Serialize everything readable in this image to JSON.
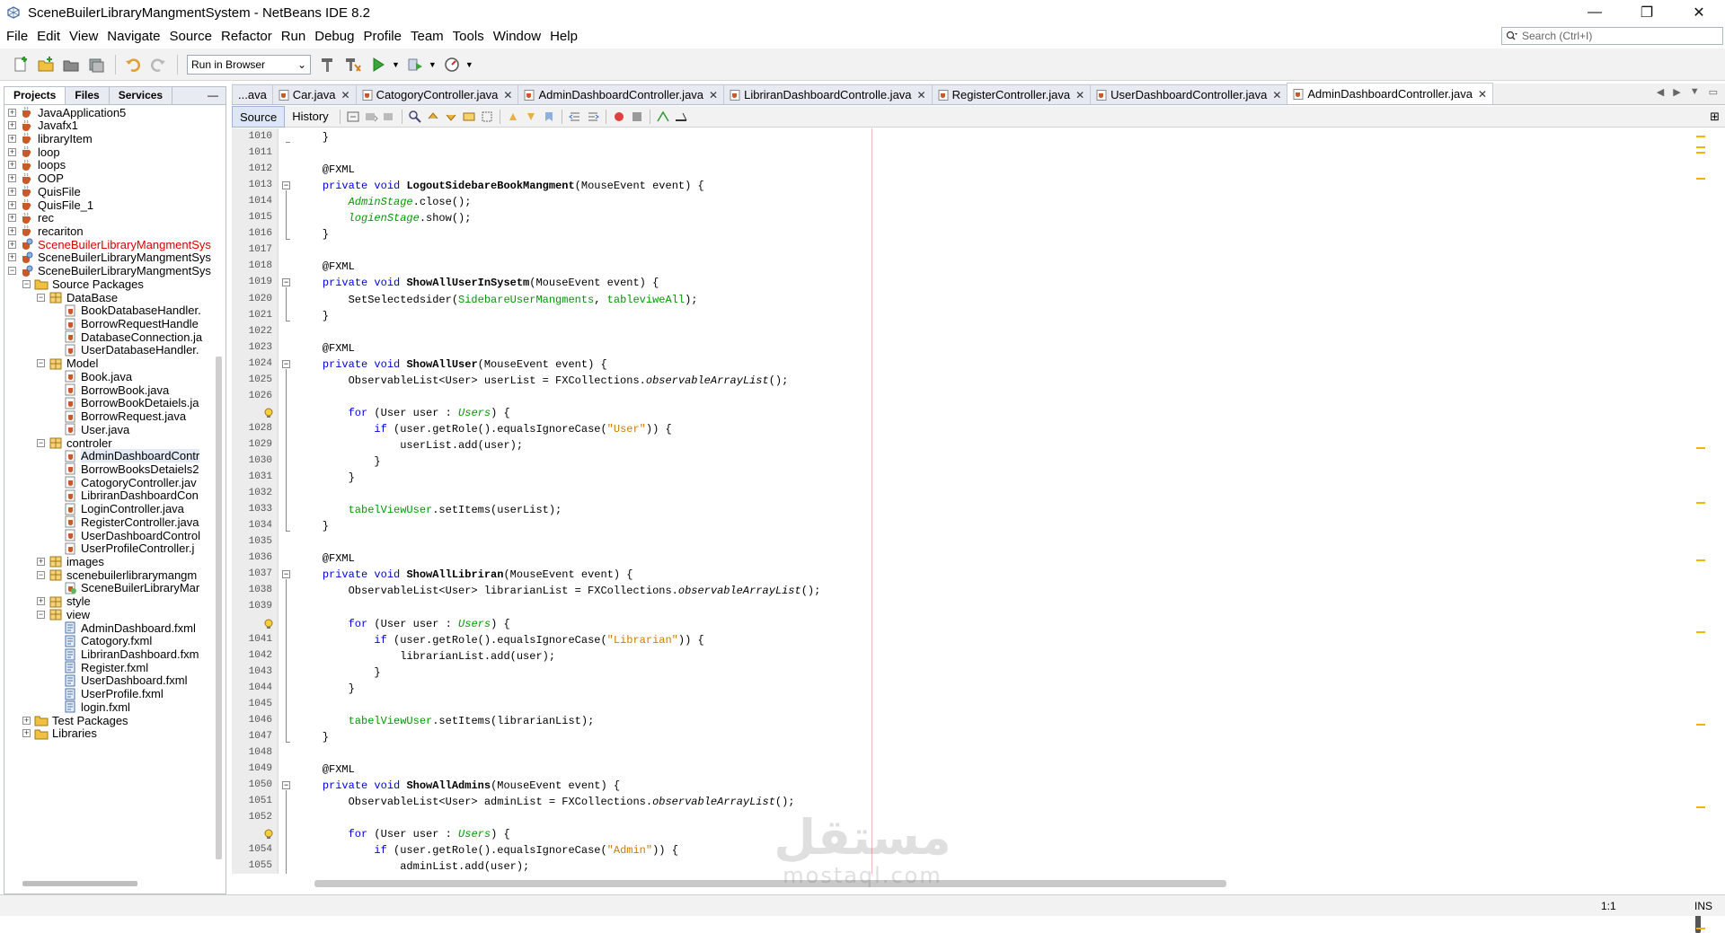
{
  "window": {
    "title": "SceneBuilerLibraryMangmentSystem - NetBeans IDE 8.2",
    "controls": [
      "—",
      "❐",
      "✕"
    ]
  },
  "menu": [
    "File",
    "Edit",
    "View",
    "Navigate",
    "Source",
    "Refactor",
    "Run",
    "Debug",
    "Profile",
    "Team",
    "Tools",
    "Window",
    "Help"
  ],
  "search": {
    "placeholder": "Search (Ctrl+I)"
  },
  "toolbar": {
    "config_value": "Run in Browser"
  },
  "left_panel": {
    "tabs": [
      "Projects",
      "Files",
      "Services"
    ],
    "minimize": "—",
    "tree": [
      {
        "label": "JavaApplication5",
        "indent": 0,
        "exp": "+",
        "icon": "project"
      },
      {
        "label": "Javafx1",
        "indent": 0,
        "exp": "+",
        "icon": "project"
      },
      {
        "label": "libraryItem",
        "indent": 0,
        "exp": "+",
        "icon": "project"
      },
      {
        "label": "loop",
        "indent": 0,
        "exp": "+",
        "icon": "project"
      },
      {
        "label": "loops",
        "indent": 0,
        "exp": "+",
        "icon": "project"
      },
      {
        "label": "OOP",
        "indent": 0,
        "exp": "+",
        "icon": "project"
      },
      {
        "label": "QuisFile",
        "indent": 0,
        "exp": "+",
        "icon": "project"
      },
      {
        "label": "QuisFile_1",
        "indent": 0,
        "exp": "+",
        "icon": "project"
      },
      {
        "label": "rec",
        "indent": 0,
        "exp": "+",
        "icon": "project"
      },
      {
        "label": "recariton",
        "indent": 0,
        "exp": "+",
        "icon": "project"
      },
      {
        "label": "SceneBuilerLibraryMangmentSys",
        "indent": 0,
        "exp": "+",
        "icon": "fxproject",
        "red": true
      },
      {
        "label": "SceneBuilerLibraryMangmentSys",
        "indent": 0,
        "exp": "+",
        "icon": "fxproject"
      },
      {
        "label": "SceneBuilerLibraryMangmentSys",
        "indent": 0,
        "exp": "−",
        "icon": "fxproject"
      },
      {
        "label": "Source Packages",
        "indent": 1,
        "exp": "−",
        "icon": "folder"
      },
      {
        "label": "DataBase",
        "indent": 2,
        "exp": "−",
        "icon": "package"
      },
      {
        "label": "BookDatabaseHandler.",
        "indent": 3,
        "exp": "",
        "icon": "java"
      },
      {
        "label": "BorrowRequestHandle",
        "indent": 3,
        "exp": "",
        "icon": "java"
      },
      {
        "label": "DatabaseConnection.ja",
        "indent": 3,
        "exp": "",
        "icon": "java"
      },
      {
        "label": "UserDatabaseHandler.",
        "indent": 3,
        "exp": "",
        "icon": "java"
      },
      {
        "label": "Model",
        "indent": 2,
        "exp": "−",
        "icon": "package"
      },
      {
        "label": "Book.java",
        "indent": 3,
        "exp": "",
        "icon": "java"
      },
      {
        "label": "BorrowBook.java",
        "indent": 3,
        "exp": "",
        "icon": "java"
      },
      {
        "label": "BorrowBookDetaiels.ja",
        "indent": 3,
        "exp": "",
        "icon": "java"
      },
      {
        "label": "BorrowRequest.java",
        "indent": 3,
        "exp": "",
        "icon": "java"
      },
      {
        "label": "User.java",
        "indent": 3,
        "exp": "",
        "icon": "java"
      },
      {
        "label": "controler",
        "indent": 2,
        "exp": "−",
        "icon": "package"
      },
      {
        "label": "AdminDashboardContr",
        "indent": 3,
        "exp": "",
        "icon": "java",
        "sel": true
      },
      {
        "label": "BorrowBooksDetaiels2",
        "indent": 3,
        "exp": "",
        "icon": "java"
      },
      {
        "label": "CatogoryController.jav",
        "indent": 3,
        "exp": "",
        "icon": "java"
      },
      {
        "label": "LibriranDashboardCon",
        "indent": 3,
        "exp": "",
        "icon": "java"
      },
      {
        "label": "LoginController.java",
        "indent": 3,
        "exp": "",
        "icon": "java"
      },
      {
        "label": "RegisterController.java",
        "indent": 3,
        "exp": "",
        "icon": "java"
      },
      {
        "label": "UserDashboardControl",
        "indent": 3,
        "exp": "",
        "icon": "java"
      },
      {
        "label": "UserProfileController.j",
        "indent": 3,
        "exp": "",
        "icon": "java"
      },
      {
        "label": "images",
        "indent": 2,
        "exp": "+",
        "icon": "package"
      },
      {
        "label": "scenebuilerlibrarymangm",
        "indent": 2,
        "exp": "−",
        "icon": "package"
      },
      {
        "label": "SceneBuilerLibraryMar",
        "indent": 3,
        "exp": "",
        "icon": "fxjava"
      },
      {
        "label": "style",
        "indent": 2,
        "exp": "+",
        "icon": "package"
      },
      {
        "label": "view",
        "indent": 2,
        "exp": "−",
        "icon": "package"
      },
      {
        "label": "AdminDashboard.fxml",
        "indent": 3,
        "exp": "",
        "icon": "fxml"
      },
      {
        "label": "Catogory.fxml",
        "indent": 3,
        "exp": "",
        "icon": "fxml"
      },
      {
        "label": "LibriranDashboard.fxm",
        "indent": 3,
        "exp": "",
        "icon": "fxml"
      },
      {
        "label": "Register.fxml",
        "indent": 3,
        "exp": "",
        "icon": "fxml"
      },
      {
        "label": "UserDashboard.fxml",
        "indent": 3,
        "exp": "",
        "icon": "fxml"
      },
      {
        "label": "UserProfile.fxml",
        "indent": 3,
        "exp": "",
        "icon": "fxml"
      },
      {
        "label": "login.fxml",
        "indent": 3,
        "exp": "",
        "icon": "fxml"
      },
      {
        "label": "Test Packages",
        "indent": 1,
        "exp": "+",
        "icon": "folder"
      },
      {
        "label": "Libraries",
        "indent": 1,
        "exp": "+",
        "icon": "folder"
      }
    ]
  },
  "editor": {
    "tabs": [
      {
        "label": "...ava",
        "x": false
      },
      {
        "label": "Car.java",
        "x": true
      },
      {
        "label": "CatogoryController.java",
        "x": true
      },
      {
        "label": "AdminDashboardController.java",
        "x": true
      },
      {
        "label": "LibriranDashboardControlle.java",
        "x": true
      },
      {
        "label": "RegisterController.java",
        "x": true
      },
      {
        "label": "UserDashboardController.java",
        "x": true
      },
      {
        "label": "AdminDashboardController.java",
        "x": true,
        "active": true
      }
    ],
    "tab_nav": [
      "◀",
      "▶",
      "▼",
      "▭"
    ],
    "source_tab": "Source",
    "history_tab": "History",
    "cursor_position": "1:1",
    "insert_mode": "INS",
    "lines": [
      {
        "n": "1010",
        "t": [
          {
            "s": "    }"
          }
        ]
      },
      {
        "n": "1011",
        "t": [
          {
            "s": ""
          }
        ]
      },
      {
        "n": "1012",
        "t": [
          {
            "s": "    @FXML",
            "c": "ann"
          }
        ]
      },
      {
        "n": "1013",
        "fold": true,
        "t": [
          {
            "s": "    "
          },
          {
            "s": "private void ",
            "c": "kw"
          },
          {
            "s": "LogoutSidebareBookMangment",
            "c": "mth"
          },
          {
            "s": "(MouseEvent event) {"
          }
        ]
      },
      {
        "n": "1014",
        "t": [
          {
            "s": "        "
          },
          {
            "s": "AdminStage",
            "c": "fld it"
          },
          {
            "s": ".close();"
          }
        ]
      },
      {
        "n": "1015",
        "t": [
          {
            "s": "        "
          },
          {
            "s": "logienStage",
            "c": "fld it"
          },
          {
            "s": ".show();"
          }
        ]
      },
      {
        "n": "1016",
        "t": [
          {
            "s": "    }"
          }
        ]
      },
      {
        "n": "1017",
        "t": [
          {
            "s": ""
          }
        ]
      },
      {
        "n": "1018",
        "t": [
          {
            "s": "    @FXML"
          }
        ]
      },
      {
        "n": "1019",
        "fold": true,
        "t": [
          {
            "s": "    "
          },
          {
            "s": "private void ",
            "c": "kw"
          },
          {
            "s": "ShowAllUserInSysetm",
            "c": "mth"
          },
          {
            "s": "(MouseEvent event) {"
          }
        ]
      },
      {
        "n": "1020",
        "t": [
          {
            "s": "        SetSelectedsider("
          },
          {
            "s": "SidebareUserMangments",
            "c": "fld"
          },
          {
            "s": ", "
          },
          {
            "s": "tableviweAll",
            "c": "fld"
          },
          {
            "s": ");"
          }
        ]
      },
      {
        "n": "1021",
        "t": [
          {
            "s": "    }"
          }
        ]
      },
      {
        "n": "1022",
        "t": [
          {
            "s": ""
          }
        ]
      },
      {
        "n": "1023",
        "t": [
          {
            "s": "    @FXML"
          }
        ]
      },
      {
        "n": "1024",
        "fold": true,
        "t": [
          {
            "s": "    "
          },
          {
            "s": "private void ",
            "c": "kw"
          },
          {
            "s": "ShowAllUser",
            "c": "mth"
          },
          {
            "s": "(MouseEvent event) {"
          }
        ]
      },
      {
        "n": "1025",
        "t": [
          {
            "s": "        ObservableList<User> userList = FXCollections."
          },
          {
            "s": "observableArrayList",
            "c": "it"
          },
          {
            "s": "();"
          }
        ]
      },
      {
        "n": "1026",
        "t": [
          {
            "s": ""
          }
        ]
      },
      {
        "n": "",
        "hint": true,
        "t": [
          {
            "s": "        "
          },
          {
            "s": "for",
            "c": "kw"
          },
          {
            "s": " (User user : "
          },
          {
            "s": "Users",
            "c": "fld it"
          },
          {
            "s": ") {"
          }
        ]
      },
      {
        "n": "1028",
        "t": [
          {
            "s": "            "
          },
          {
            "s": "if",
            "c": "kw"
          },
          {
            "s": " (user.getRole().equalsIgnoreCase("
          },
          {
            "s": "\"User\"",
            "c": "str"
          },
          {
            "s": ")) {"
          }
        ]
      },
      {
        "n": "1029",
        "t": [
          {
            "s": "                userList.add(user);"
          }
        ]
      },
      {
        "n": "1030",
        "t": [
          {
            "s": "            }"
          }
        ]
      },
      {
        "n": "1031",
        "t": [
          {
            "s": "        }"
          }
        ]
      },
      {
        "n": "1032",
        "t": [
          {
            "s": ""
          }
        ]
      },
      {
        "n": "1033",
        "t": [
          {
            "s": "        "
          },
          {
            "s": "tabelViewUser",
            "c": "fld"
          },
          {
            "s": ".setItems(userList);"
          }
        ]
      },
      {
        "n": "1034",
        "t": [
          {
            "s": "    }"
          }
        ]
      },
      {
        "n": "1035",
        "t": [
          {
            "s": ""
          }
        ]
      },
      {
        "n": "1036",
        "t": [
          {
            "s": "    @FXML"
          }
        ]
      },
      {
        "n": "1037",
        "fold": true,
        "t": [
          {
            "s": "    "
          },
          {
            "s": "private void ",
            "c": "kw"
          },
          {
            "s": "ShowAllLibriran",
            "c": "mth"
          },
          {
            "s": "(MouseEvent event) {"
          }
        ]
      },
      {
        "n": "1038",
        "t": [
          {
            "s": "        ObservableList<User> librarianList = FXCollections."
          },
          {
            "s": "observableArrayList",
            "c": "it"
          },
          {
            "s": "();"
          }
        ]
      },
      {
        "n": "1039",
        "t": [
          {
            "s": ""
          }
        ]
      },
      {
        "n": "",
        "hint": true,
        "t": [
          {
            "s": "        "
          },
          {
            "s": "for",
            "c": "kw"
          },
          {
            "s": " (User user : "
          },
          {
            "s": "Users",
            "c": "fld it"
          },
          {
            "s": ") {"
          }
        ]
      },
      {
        "n": "1041",
        "t": [
          {
            "s": "            "
          },
          {
            "s": "if",
            "c": "kw"
          },
          {
            "s": " (user.getRole().equalsIgnoreCase("
          },
          {
            "s": "\"Librarian\"",
            "c": "str"
          },
          {
            "s": ")) {"
          }
        ]
      },
      {
        "n": "1042",
        "t": [
          {
            "s": "                librarianList.add(user);"
          }
        ]
      },
      {
        "n": "1043",
        "t": [
          {
            "s": "            }"
          }
        ]
      },
      {
        "n": "1044",
        "t": [
          {
            "s": "        }"
          }
        ]
      },
      {
        "n": "1045",
        "t": [
          {
            "s": ""
          }
        ]
      },
      {
        "n": "1046",
        "t": [
          {
            "s": "        "
          },
          {
            "s": "tabelViewUser",
            "c": "fld"
          },
          {
            "s": ".setItems(librarianList);"
          }
        ]
      },
      {
        "n": "1047",
        "t": [
          {
            "s": "    }"
          }
        ]
      },
      {
        "n": "1048",
        "t": [
          {
            "s": ""
          }
        ]
      },
      {
        "n": "1049",
        "t": [
          {
            "s": "    @FXML"
          }
        ]
      },
      {
        "n": "1050",
        "fold": true,
        "t": [
          {
            "s": "    "
          },
          {
            "s": "private void ",
            "c": "kw"
          },
          {
            "s": "ShowAllAdmins",
            "c": "mth"
          },
          {
            "s": "(MouseEvent event) {"
          }
        ]
      },
      {
        "n": "1051",
        "t": [
          {
            "s": "        ObservableList<User> adminList = FXCollections."
          },
          {
            "s": "observableArrayList",
            "c": "it"
          },
          {
            "s": "();"
          }
        ]
      },
      {
        "n": "1052",
        "t": [
          {
            "s": ""
          }
        ]
      },
      {
        "n": "",
        "hint": true,
        "t": [
          {
            "s": "        "
          },
          {
            "s": "for",
            "c": "kw"
          },
          {
            "s": " (User user : "
          },
          {
            "s": "Users",
            "c": "fld it"
          },
          {
            "s": ") {"
          }
        ]
      },
      {
        "n": "1054",
        "t": [
          {
            "s": "            "
          },
          {
            "s": "if",
            "c": "kw"
          },
          {
            "s": " (user.getRole().equalsIgnoreCase("
          },
          {
            "s": "\"Admin\"",
            "c": "str"
          },
          {
            "s": ")) {"
          }
        ]
      },
      {
        "n": "1055",
        "t": [
          {
            "s": "                adminList.add(user);"
          }
        ]
      }
    ]
  },
  "watermark": {
    "arabic": "مستقل",
    "latin": "mostaql.com"
  }
}
